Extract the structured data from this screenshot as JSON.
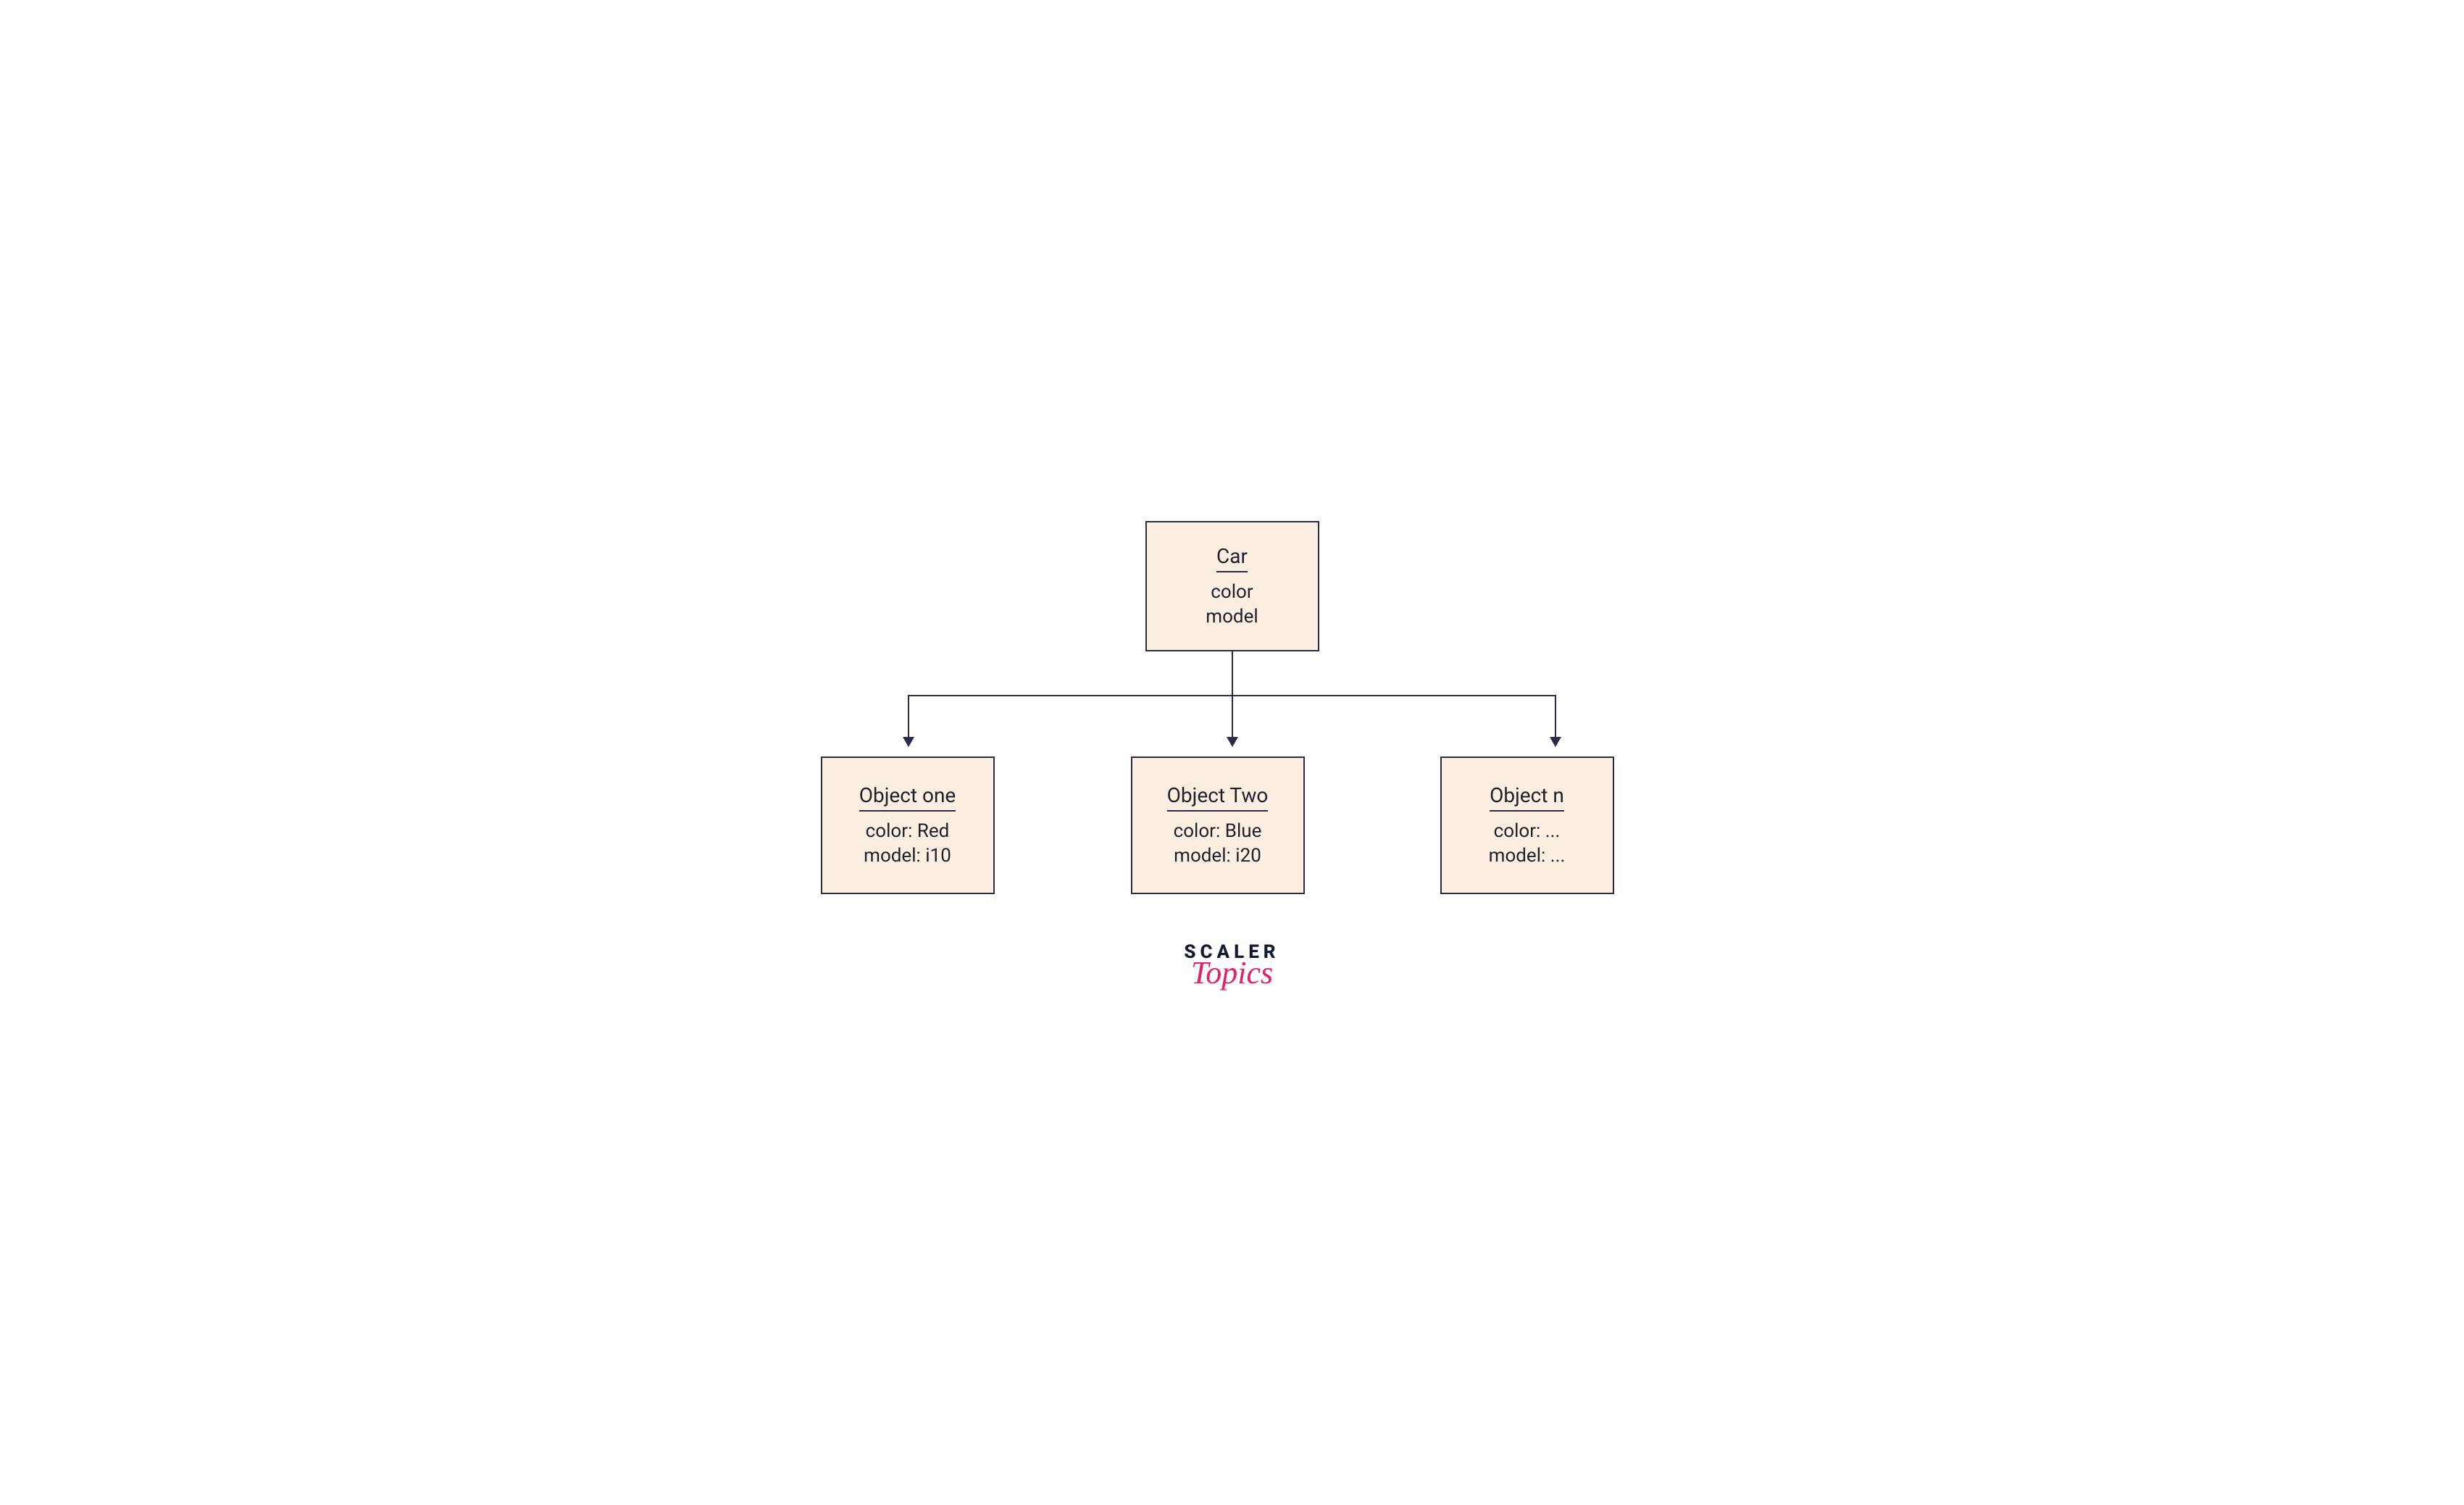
{
  "class_box": {
    "title": "Car",
    "attrs": [
      "color",
      "model"
    ]
  },
  "objects": [
    {
      "title": "Object one",
      "attrs": [
        "color: Red",
        "model: i10"
      ]
    },
    {
      "title": "Object Two",
      "attrs": [
        "color: Blue",
        "model: i20"
      ]
    },
    {
      "title": "Object n",
      "attrs": [
        "color: ...",
        "model: ..."
      ]
    }
  ],
  "logo": {
    "line1": "SCALER",
    "line2": "Topics"
  }
}
